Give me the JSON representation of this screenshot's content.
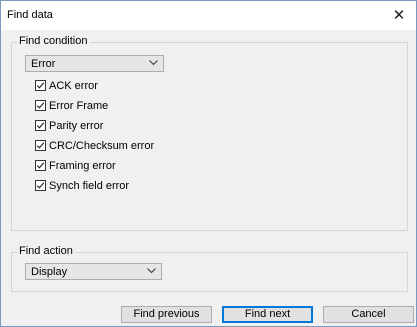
{
  "window": {
    "title": "Find data",
    "close_glyph": "✕"
  },
  "find_condition": {
    "label": "Find condition",
    "selected": "Error",
    "checkboxes": [
      {
        "label": "ACK error",
        "checked": true
      },
      {
        "label": "Error Frame",
        "checked": true
      },
      {
        "label": "Parity error",
        "checked": true
      },
      {
        "label": "CRC/Checksum error",
        "checked": true
      },
      {
        "label": "Framing error",
        "checked": true
      },
      {
        "label": "Synch field error",
        "checked": true
      }
    ]
  },
  "find_action": {
    "label": "Find action",
    "selected": "Display"
  },
  "buttons": {
    "find_previous": "Find previous",
    "find_next": "Find next",
    "cancel": "Cancel"
  },
  "colors": {
    "dialog_bg": "#f0f0f0",
    "default_button_border": "#0078d7"
  }
}
